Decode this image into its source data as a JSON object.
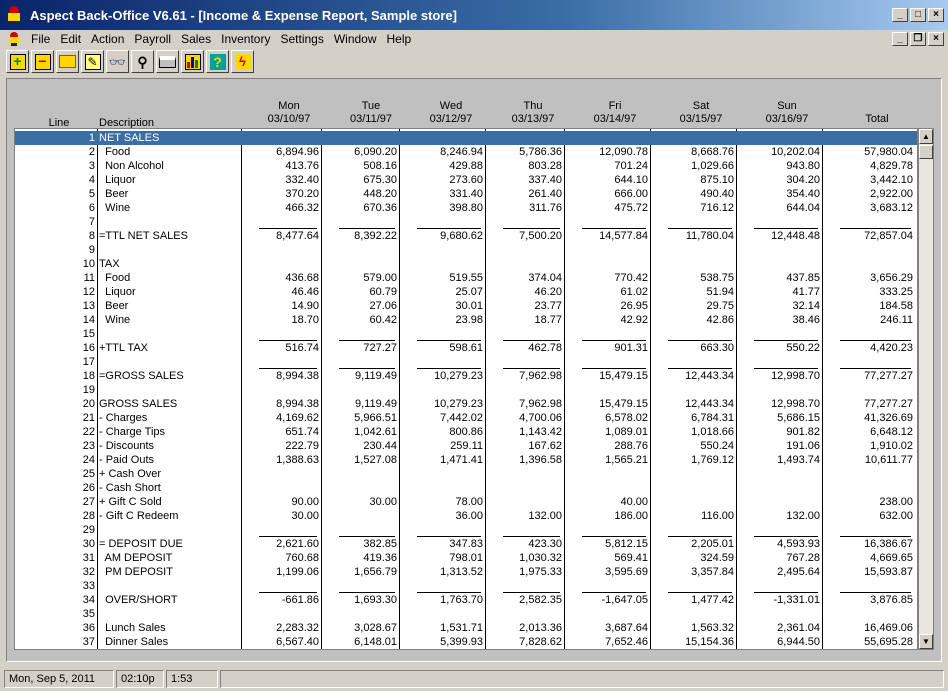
{
  "window": {
    "title": "Aspect Back-Office V6.61 - [Income & Expense Report, Sample store]"
  },
  "menu": [
    "File",
    "Edit",
    "Action",
    "Payroll",
    "Sales",
    "Inventory",
    "Settings",
    "Window",
    "Help"
  ],
  "toolbar": [
    "add-icon",
    "remove-icon",
    "folder-icon",
    "edit-note-icon",
    "binoculars-icon",
    "magnifier-icon",
    "printer-icon",
    "chart-icon",
    "help-icon",
    "lightning-icon"
  ],
  "colors": {
    "selection": "#3a6ea5",
    "title_start": "#0a246a",
    "title_end": "#a6caf0"
  },
  "headers": {
    "line": "Line",
    "description": "Description",
    "days": [
      {
        "day": "Mon",
        "date": "03/10/97"
      },
      {
        "day": "Tue",
        "date": "03/11/97"
      },
      {
        "day": "Wed",
        "date": "03/12/97"
      },
      {
        "day": "Thu",
        "date": "03/13/97"
      },
      {
        "day": "Fri",
        "date": "03/14/97"
      },
      {
        "day": "Sat",
        "date": "03/15/97"
      },
      {
        "day": "Sun",
        "date": "03/16/97"
      }
    ],
    "total": "Total"
  },
  "rows": [
    {
      "line": "1",
      "desc": "NET SALES",
      "vals": [
        "",
        "",
        "",
        "",
        "",
        "",
        "",
        ""
      ],
      "selected": true
    },
    {
      "line": "2",
      "desc": "  Food",
      "vals": [
        "6,894.96",
        "6,090.20",
        "8,246.94",
        "5,786.36",
        "12,090.78",
        "8,668.76",
        "10,202.04",
        "57,980.04"
      ]
    },
    {
      "line": "3",
      "desc": "  Non Alcohol",
      "vals": [
        "413.76",
        "508.16",
        "429.88",
        "803.28",
        "701.24",
        "1,029.66",
        "943.80",
        "4,829.78"
      ]
    },
    {
      "line": "4",
      "desc": "  Liquor",
      "vals": [
        "332.40",
        "675.30",
        "273.60",
        "337.40",
        "644.10",
        "875.10",
        "304.20",
        "3,442.10"
      ]
    },
    {
      "line": "5",
      "desc": "  Beer",
      "vals": [
        "370.20",
        "448.20",
        "331.40",
        "261.40",
        "666.00",
        "490.40",
        "354.40",
        "2,922.00"
      ]
    },
    {
      "line": "6",
      "desc": "  Wine",
      "vals": [
        "466.32",
        "670.36",
        "398.80",
        "311.76",
        "475.72",
        "716.12",
        "644.04",
        "3,683.12"
      ]
    },
    {
      "line": "7",
      "desc": "",
      "vals": [
        "",
        "",
        "",
        "",
        "",
        "",
        "",
        ""
      ],
      "underline": true
    },
    {
      "line": "8",
      "desc": "=TTL NET SALES",
      "vals": [
        "8,477.64",
        "8,392.22",
        "9,680.62",
        "7,500.20",
        "14,577.84",
        "11,780.04",
        "12,448.48",
        "72,857.04"
      ]
    },
    {
      "line": "9",
      "desc": "",
      "vals": [
        "",
        "",
        "",
        "",
        "",
        "",
        "",
        ""
      ]
    },
    {
      "line": "10",
      "desc": "TAX",
      "vals": [
        "",
        "",
        "",
        "",
        "",
        "",
        "",
        ""
      ]
    },
    {
      "line": "11",
      "desc": "  Food",
      "vals": [
        "436.68",
        "579.00",
        "519.55",
        "374.04",
        "770.42",
        "538.75",
        "437.85",
        "3,656.29"
      ]
    },
    {
      "line": "12",
      "desc": "  Liquor",
      "vals": [
        "46.46",
        "60.79",
        "25.07",
        "46.20",
        "61.02",
        "51.94",
        "41.77",
        "333.25"
      ]
    },
    {
      "line": "13",
      "desc": "  Beer",
      "vals": [
        "14.90",
        "27.06",
        "30.01",
        "23.77",
        "26.95",
        "29.75",
        "32.14",
        "184.58"
      ]
    },
    {
      "line": "14",
      "desc": "  Wine",
      "vals": [
        "18.70",
        "60.42",
        "23.98",
        "18.77",
        "42.92",
        "42.86",
        "38.46",
        "246.11"
      ]
    },
    {
      "line": "15",
      "desc": "",
      "vals": [
        "",
        "",
        "",
        "",
        "",
        "",
        "",
        ""
      ],
      "underline": true
    },
    {
      "line": "16",
      "desc": "+TTL TAX",
      "vals": [
        "516.74",
        "727.27",
        "598.61",
        "462.78",
        "901.31",
        "663.30",
        "550.22",
        "4,420.23"
      ]
    },
    {
      "line": "17",
      "desc": "",
      "vals": [
        "",
        "",
        "",
        "",
        "",
        "",
        "",
        ""
      ],
      "underline": true
    },
    {
      "line": "18",
      "desc": "=GROSS SALES",
      "vals": [
        "8,994.38",
        "9,119.49",
        "10,279.23",
        "7,962.98",
        "15,479.15",
        "12,443.34",
        "12,998.70",
        "77,277.27"
      ]
    },
    {
      "line": "19",
      "desc": "",
      "vals": [
        "",
        "",
        "",
        "",
        "",
        "",
        "",
        ""
      ]
    },
    {
      "line": "20",
      "desc": "GROSS SALES",
      "vals": [
        "8,994.38",
        "9,119.49",
        "10,279.23",
        "7,962.98",
        "15,479.15",
        "12,443.34",
        "12,998.70",
        "77,277.27"
      ]
    },
    {
      "line": "21",
      "desc": "- Charges",
      "vals": [
        "4,169.62",
        "5,966.51",
        "7,442.02",
        "4,700.06",
        "6,578.02",
        "6,784.31",
        "5,686.15",
        "41,326.69"
      ]
    },
    {
      "line": "22",
      "desc": "- Charge Tips",
      "vals": [
        "651.74",
        "1,042.61",
        "800.86",
        "1,143.42",
        "1,089.01",
        "1,018.66",
        "901.82",
        "6,648.12"
      ]
    },
    {
      "line": "23",
      "desc": "- Discounts",
      "vals": [
        "222.79",
        "230.44",
        "259.11",
        "167.62",
        "288.76",
        "550.24",
        "191.06",
        "1,910.02"
      ]
    },
    {
      "line": "24",
      "desc": "- Paid Outs",
      "vals": [
        "1,388.63",
        "1,527.08",
        "1,471.41",
        "1,396.58",
        "1,565.21",
        "1,769.12",
        "1,493.74",
        "10,611.77"
      ]
    },
    {
      "line": "25",
      "desc": "+ Cash Over",
      "vals": [
        "",
        "",
        "",
        "",
        "",
        "",
        "",
        ""
      ]
    },
    {
      "line": "26",
      "desc": "- Cash Short",
      "vals": [
        "",
        "",
        "",
        "",
        "",
        "",
        "",
        ""
      ]
    },
    {
      "line": "27",
      "desc": "+ Gift C Sold",
      "vals": [
        "90.00",
        "30.00",
        "78.00",
        "",
        "40.00",
        "",
        "",
        "238.00"
      ]
    },
    {
      "line": "28",
      "desc": "- Gift C Redeem",
      "vals": [
        "30.00",
        "",
        "36.00",
        "132.00",
        "186.00",
        "116.00",
        "132.00",
        "632.00"
      ]
    },
    {
      "line": "29",
      "desc": "",
      "vals": [
        "",
        "",
        "",
        "",
        "",
        "",
        "",
        ""
      ],
      "underline": true
    },
    {
      "line": "30",
      "desc": "= DEPOSIT DUE",
      "vals": [
        "2,621.60",
        "382.85",
        "347.83",
        "423.30",
        "5,812.15",
        "2,205.01",
        "4,593.93",
        "16,386.67"
      ]
    },
    {
      "line": "31",
      "desc": "  AM DEPOSIT",
      "vals": [
        "760.68",
        "419.36",
        "798.01",
        "1,030.32",
        "569.41",
        "324.59",
        "767.28",
        "4,669.65"
      ]
    },
    {
      "line": "32",
      "desc": "  PM DEPOSIT",
      "vals": [
        "1,199.06",
        "1,656.79",
        "1,313.52",
        "1,975.33",
        "3,595.69",
        "3,357.84",
        "2,495.64",
        "15,593.87"
      ]
    },
    {
      "line": "33",
      "desc": "",
      "vals": [
        "",
        "",
        "",
        "",
        "",
        "",
        "",
        ""
      ],
      "underline": true
    },
    {
      "line": "34",
      "desc": "  OVER/SHORT",
      "vals": [
        "-661.86",
        "1,693.30",
        "1,763.70",
        "2,582.35",
        "-1,647.05",
        "1,477.42",
        "-1,331.01",
        "3,876.85"
      ]
    },
    {
      "line": "35",
      "desc": "",
      "vals": [
        "",
        "",
        "",
        "",
        "",
        "",
        "",
        ""
      ]
    },
    {
      "line": "36",
      "desc": "  Lunch Sales",
      "vals": [
        "2,283.32",
        "3,028.67",
        "1,531.71",
        "2,013.36",
        "3,687.64",
        "1,563.32",
        "2,361.04",
        "16,469.06"
      ]
    },
    {
      "line": "37",
      "desc": "  Dinner Sales",
      "vals": [
        "6,567.40",
        "6,148.01",
        "5,399.93",
        "7,828.62",
        "7,652.46",
        "15,154.36",
        "6,944.50",
        "55,695.28"
      ]
    }
  ],
  "status": {
    "date": "Mon, Sep 5, 2011",
    "time": "02:10p",
    "elapsed": "1:53"
  }
}
